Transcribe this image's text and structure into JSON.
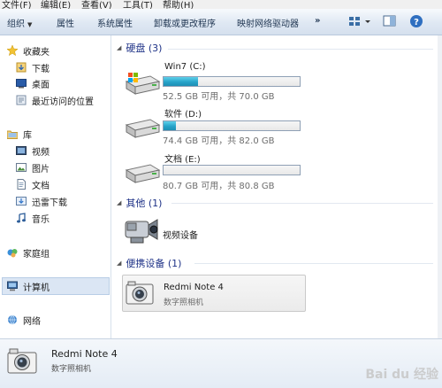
{
  "menu": [
    "文件(F)",
    "编辑(E)",
    "查看(V)",
    "工具(T)",
    "帮助(H)"
  ],
  "toolbar": {
    "organize": "组织",
    "properties": "属性",
    "system_properties": "系统属性",
    "uninstall": "卸载或更改程序",
    "map_drive": "映射网络驱动器",
    "more": "»"
  },
  "nav": {
    "favorites": "收藏夹",
    "downloads": "下载",
    "desktop": "桌面",
    "recent": "最近访问的位置",
    "libraries": "库",
    "videos": "视频",
    "pictures": "图片",
    "documents": "文档",
    "xunlei": "迅雷下载",
    "music": "音乐",
    "homegroup": "家庭组",
    "computer": "计算机",
    "network": "网络"
  },
  "groups": {
    "hdd": "硬盘 (3)",
    "other": "其他 (1)",
    "portable": "便携设备 (1)"
  },
  "drives": [
    {
      "name": "Win7 (C:)",
      "free": "52.5 GB 可用，共 70.0 GB",
      "used_fraction": 0.25
    },
    {
      "name": "软件 (D:)",
      "free": "74.4 GB 可用，共 82.0 GB",
      "used_fraction": 0.09
    },
    {
      "name": "文档 (E:)",
      "free": "80.7 GB 可用，共 80.8 GB",
      "used_fraction": 0.0
    }
  ],
  "other_device": {
    "name": "视频设备"
  },
  "portable_device": {
    "name": "Redmi Note 4",
    "type": "数字照相机"
  },
  "details": {
    "name": "Redmi Note 4",
    "type": "数字照相机"
  },
  "colors": {
    "accent": "#1e3287",
    "bar_fill": "#27a3c9"
  },
  "watermark": "Bai du 经验"
}
